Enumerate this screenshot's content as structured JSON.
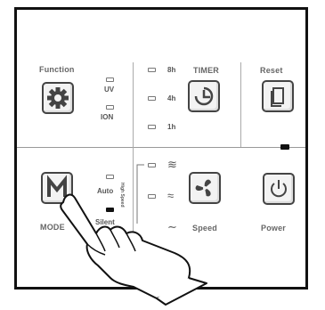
{
  "labels": {
    "function": "Function",
    "timer": "TIMER",
    "reset": "Reset",
    "mode": "MODE",
    "speed": "Speed",
    "power": "Power"
  },
  "function_options": [
    "UV",
    "ION"
  ],
  "timer_options": [
    "8h",
    "4h",
    "1h"
  ],
  "mode_options": [
    "Auto",
    "Silent"
  ],
  "speed_label_vertical": "High Speed",
  "indicators": {
    "uv": false,
    "ion": false,
    "timer_8h": false,
    "timer_4h": false,
    "timer_1h": false,
    "auto": false,
    "silent": true,
    "speed_high": false,
    "speed_mid": false,
    "reset": true
  },
  "icons": {
    "function": "gear-icon",
    "timer": "clock-icon",
    "reset": "filter-reset-icon",
    "mode": "m-letter-icon",
    "speed": "fan-icon",
    "power": "power-icon",
    "hand": "pointing-hand-icon"
  },
  "colors": {
    "indicator_on": "#111111",
    "panel_border": "#111111"
  }
}
